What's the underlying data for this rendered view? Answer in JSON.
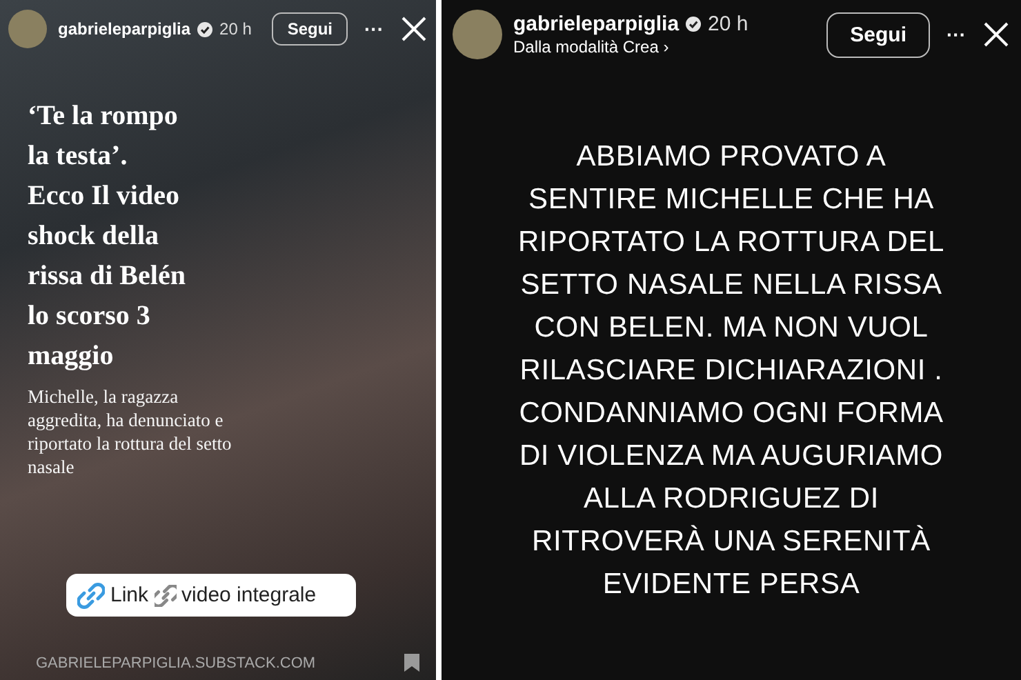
{
  "stories": [
    {
      "kind": "link",
      "author": "gabrieleparpiglia",
      "verified": true,
      "time": "20 h",
      "follow": "Segui",
      "more": "···",
      "headline": [
        "‘Te la rompo",
        "la testa’.",
        "Ecco Il video",
        "shock della",
        "rissa di Belén",
        "lo scorso 3",
        "maggio"
      ],
      "summary": [
        "Michelle, la ragazza",
        "aggredita, ha denunciato e",
        "riportato la rottura del setto",
        "nasale"
      ],
      "link_label": "Link",
      "link_text": "video integrale",
      "source": "GABRIELEPARPIGLIA.SUBSTACK.COM"
    },
    {
      "kind": "text",
      "author": "gabrieleparpiglia",
      "verified": true,
      "time": "20 h",
      "follow": "Segui",
      "more": "···",
      "subtitle": "Dalla modalità Crea ›",
      "lines": [
        "ABBIAMO PROVATO A",
        "SENTIRE MICHELLE CHE HA",
        "RIPORTATO LA ROTTURA DEL",
        "SETTO NASALE NELLA RISSA",
        "CON BELEN. MA NON VUOL",
        "RILASCIARE DICHIARAZIONI .",
        "CONDANNIAMO OGNI FORMA",
        "DI VIOLENZA MA AUGURIAMO",
        "ALLA RODRIGUEZ DI",
        "RITROVERÀ UNA SERENITÀ",
        "EVIDENTE PERSA"
      ]
    }
  ]
}
